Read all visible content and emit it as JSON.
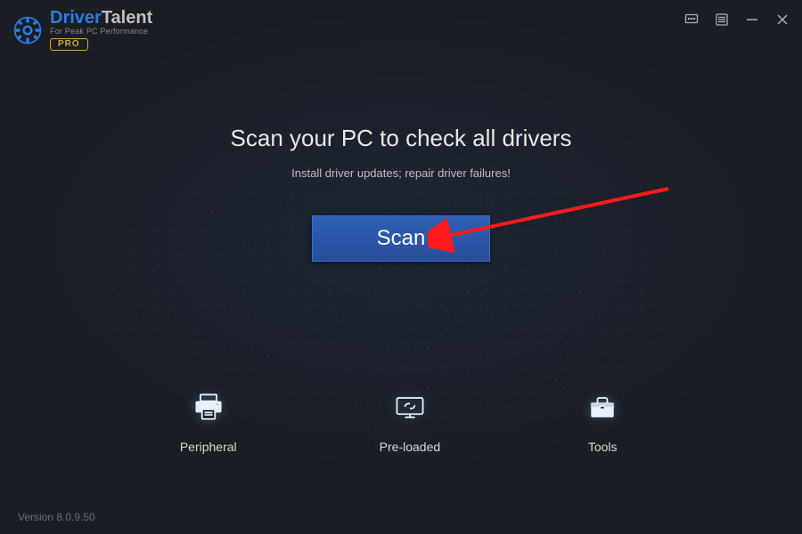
{
  "app": {
    "name_part1": "Driver",
    "name_part2": "Talent",
    "tagline": "For Peak PC Performance",
    "edition_badge": "PRO"
  },
  "window_controls": {
    "feedback_icon": "feedback",
    "menu_icon": "menu",
    "minimize_icon": "minimize",
    "close_icon": "close"
  },
  "main": {
    "headline": "Scan your PC to check all drivers",
    "subhead": "Install driver updates; repair driver failures!",
    "scan_button_label": "Scan"
  },
  "tools": [
    {
      "id": "peripheral",
      "label": "Peripheral",
      "icon": "printer"
    },
    {
      "id": "preloaded",
      "label": "Pre-loaded",
      "icon": "monitor-link"
    },
    {
      "id": "tools",
      "label": "Tools",
      "icon": "toolbox"
    }
  ],
  "footer": {
    "version_label": "Version 8.0.9.50"
  },
  "colors": {
    "accent_blue": "#2a7de1",
    "button_blue": "#2b57a5",
    "badge_gold": "#d8a43a",
    "arrow_red": "#ff1a1a"
  },
  "annotation": {
    "arrow_points_to": "scan-button"
  }
}
